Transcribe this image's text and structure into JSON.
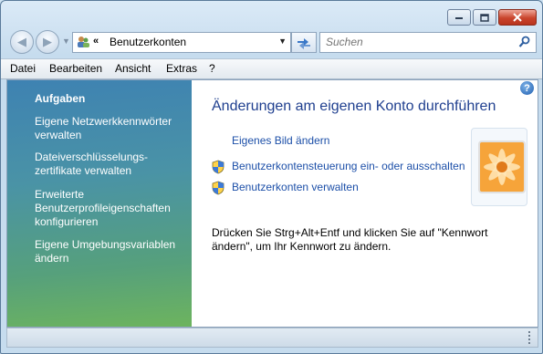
{
  "window": {
    "address_title": "Benutzerkonten",
    "search_placeholder": "Suchen",
    "caption_buttons": [
      "minimize-icon",
      "maximize-icon",
      "close-icon"
    ]
  },
  "menu": [
    "Datei",
    "Bearbeiten",
    "Ansicht",
    "Extras",
    "?"
  ],
  "sidebar": {
    "heading": "Aufgaben",
    "items": [
      "Eigene Netzwerkkennwörter verwalten",
      "Dateiverschlüsselungs-zertifikate verwalten",
      "Erweiterte Benutzerprofileigenschaften konfigurieren",
      "Eigene Umgebungsvariablen ändern"
    ]
  },
  "main": {
    "title": "Änderungen am eigenen Konto durchführen",
    "tasks": [
      {
        "label": "Eigenes Bild ändern",
        "icon": ""
      },
      {
        "label": "Benutzerkontensteuerung ein- oder ausschalten",
        "icon": "shield-icon"
      },
      {
        "label": "Benutzerkonten verwalten",
        "icon": "shield-icon"
      }
    ],
    "info_text": "Drücken Sie Strg+Alt+Entf und klicken Sie auf \"Kennwort ändern\", um Ihr Kennwort zu ändern.",
    "help_symbol": "?"
  },
  "colors": {
    "link": "#1c4fa8",
    "title": "#1f3f8f",
    "sidebar_top": "#3e82b2",
    "sidebar_bottom": "#6db45e"
  }
}
